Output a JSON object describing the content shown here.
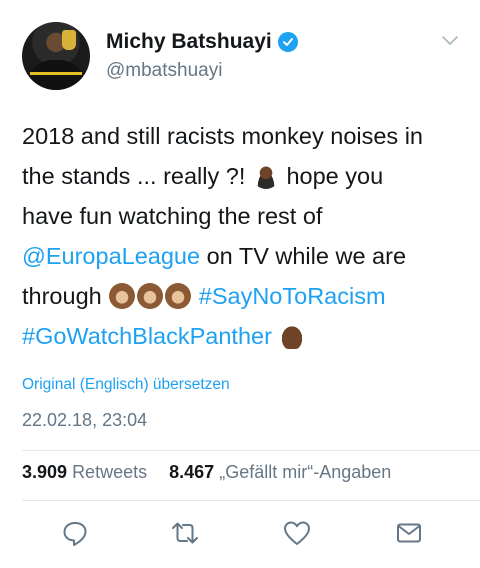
{
  "user": {
    "name": "Michy Batshuayi",
    "handle": "@mbatshuayi"
  },
  "tweet": {
    "line1": "2018 and still racists monkey noises in",
    "line2_a": "the stands ... really ?!",
    "line2_b": "hope you",
    "line3": "have fun watching the rest of",
    "mention": "@EuropaLeague",
    "line4_rest": " on TV while we are",
    "line5_a": "through",
    "hashtag1": "#SayNoToRacism",
    "hashtag2": "#GoWatchBlackPanther"
  },
  "translate_link": "Original (Englisch) übersetzen",
  "timestamp": "22.02.18, 23:04",
  "stats": {
    "retweets_count": "3.909",
    "retweets_label": "Retweets",
    "likes_count": "8.467",
    "likes_label": "„Gefällt mir“-Angaben"
  },
  "colors": {
    "accent": "#1da1f2",
    "text": "#14171a",
    "muted": "#657786",
    "divider": "#e1e8ed"
  },
  "icons": {
    "reply": "reply-icon",
    "retweet": "retweet-icon",
    "like": "heart-icon",
    "dm": "envelope-icon",
    "more": "chevron-down-icon",
    "verified": "verified-badge-icon"
  }
}
